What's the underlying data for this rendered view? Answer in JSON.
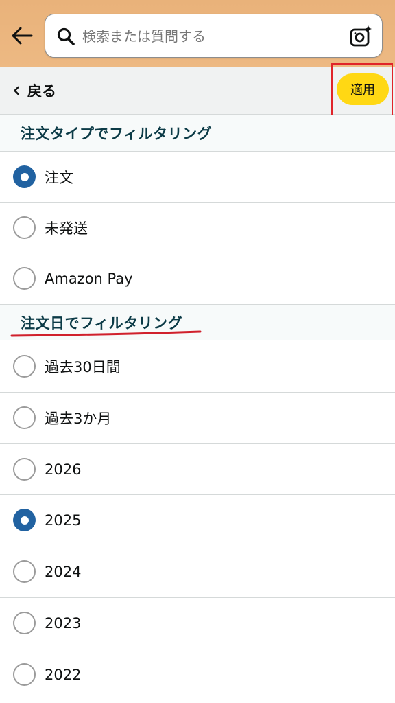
{
  "search": {
    "placeholder": "検索または質問する"
  },
  "subbar": {
    "back_label": "戻る",
    "apply_label": "適用"
  },
  "order_type_section": {
    "title": "注文タイプでフィルタリング",
    "options": [
      {
        "label": "注文",
        "checked": true
      },
      {
        "label": "未発送",
        "checked": false
      },
      {
        "label": "Amazon Pay",
        "checked": false
      }
    ]
  },
  "order_date_section": {
    "title": "注文日でフィルタリング",
    "options": [
      {
        "label": "過去30日間",
        "checked": false
      },
      {
        "label": "過去3か月",
        "checked": false
      },
      {
        "label": "2026",
        "checked": false
      },
      {
        "label": "2025",
        "checked": true
      },
      {
        "label": "2024",
        "checked": false
      },
      {
        "label": "2023",
        "checked": false
      },
      {
        "label": "2022",
        "checked": false
      }
    ]
  },
  "colors": {
    "header_bg": "#edb983",
    "apply_button": "#ffd814",
    "radio_selected": "#2162a1",
    "section_title": "#0c3b47",
    "highlight_box": "#e0242a",
    "underline_mark": "#d0202c"
  }
}
